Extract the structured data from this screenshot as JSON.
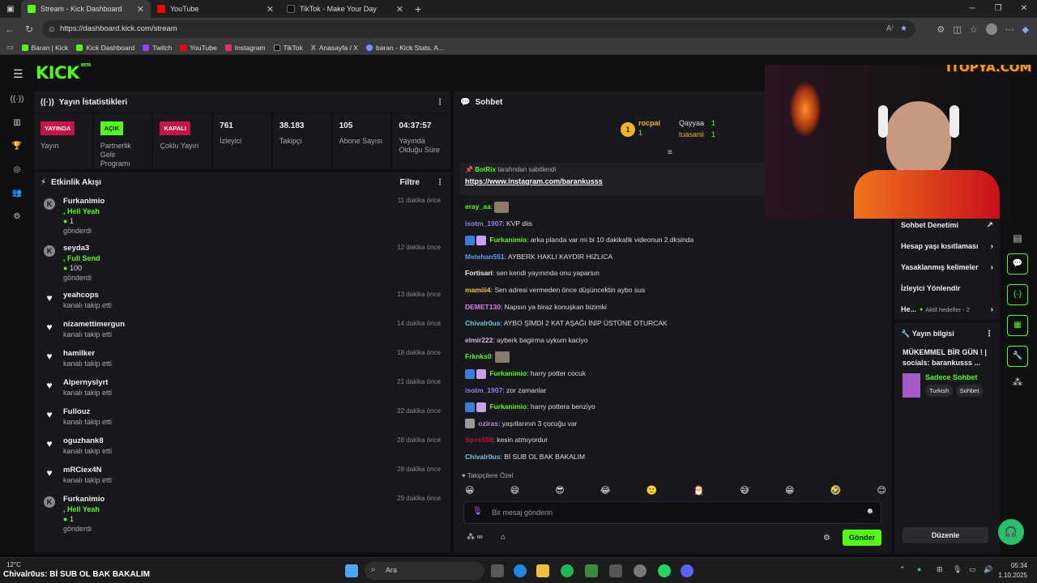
{
  "browser": {
    "tabs": [
      {
        "title": "Stream - Kick Dashboard",
        "color": "#53fc18"
      },
      {
        "title": "YouTube",
        "color": "#ff0000"
      },
      {
        "title": "TikTok - Make Your Day",
        "color": "#111111"
      }
    ],
    "url": "https://dashboard.kick.com/stream",
    "bookmarks": [
      "Baran | Kick",
      "Kick Dashboard",
      "Twitch",
      "YouTube",
      "Instagram",
      "TikTok",
      "Anasayfa / X",
      "baran - Kick Stats, A..."
    ]
  },
  "overlay": {
    "brand": "İTOPYA.COM"
  },
  "stats_panel": {
    "title": "Yayın İstatistikleri",
    "items": [
      {
        "badge": "YAYINDA",
        "label": "Yayın"
      },
      {
        "badge": "AÇIK",
        "label": "Partnerlik Gelir Programı"
      },
      {
        "badge": "KAPALI",
        "label": "Çoklu Yayın"
      },
      {
        "value": "761",
        "label": "İzleyici"
      },
      {
        "value": "38.183",
        "label": "Takipçi"
      },
      {
        "value": "105",
        "label": "Abone Sayısı"
      },
      {
        "value": "04:37:57",
        "label": "Yayında Olduğu Süre"
      }
    ]
  },
  "activity": {
    "title": "Etkinlik Akışı",
    "filter": "Filtre",
    "items": [
      {
        "user": "Furkanimio",
        "action": ", Hell Yeah",
        "amount": "1",
        "sub": "gönderdi",
        "time": "11 dakika önce",
        "kind": "kick"
      },
      {
        "user": "seyda3",
        "action": ", Full Send",
        "amount": "100",
        "sub": "gönderdi",
        "time": "12 dakika önce",
        "kind": "kick"
      },
      {
        "user": "yeahcops",
        "sub": "kanalı takip etti",
        "time": "13 dakika önce",
        "kind": "heart"
      },
      {
        "user": "nizamettimergun",
        "sub": "kanalı takip etti",
        "time": "14 dakika önce",
        "kind": "heart"
      },
      {
        "user": "hamilker",
        "sub": "kanalı takip etti",
        "time": "18 dakika önce",
        "kind": "heart"
      },
      {
        "user": "Alpernyslyrt",
        "sub": "kanalı takip etti",
        "time": "21 dakika önce",
        "kind": "heart"
      },
      {
        "user": "Fullouz",
        "sub": "kanalı takip etti",
        "time": "22 dakika önce",
        "kind": "heart"
      },
      {
        "user": "oguzhank8",
        "sub": "kanalı takip etti",
        "time": "28 dakika önce",
        "kind": "heart"
      },
      {
        "user": "mRCiex4N",
        "sub": "kanalı takip etti",
        "time": "28 dakika önce",
        "kind": "heart"
      },
      {
        "user": "Furkanimio",
        "action": ", Hell Yeah",
        "amount": "1",
        "sub": "gönderdi",
        "time": "29 dakika önce",
        "kind": "kick"
      }
    ]
  },
  "chat": {
    "title": "Sohbet",
    "leaders": [
      {
        "rank": "1",
        "name": "rocpai",
        "count": "1"
      },
      {
        "name": "Qayyaa",
        "count": "1"
      },
      {
        "name": "tuasanii",
        "count": "1"
      }
    ],
    "pinned_by": "BotRix",
    "pinned_suffix": "tarafından sabitlendi",
    "pinned_link": "https://www.instagram.com/barankusss",
    "messages": [
      {
        "user": "eray_aa",
        "text": "",
        "color": "#53fc18"
      },
      {
        "user": "isotm_1907",
        "text": ": KVP diis",
        "color": "#9b7cf5"
      },
      {
        "user": "Furkanimio",
        "text": ": arka planda var mi bi 10 dakikalik videonun 2.dksinda",
        "color": "#53fc18"
      },
      {
        "user": "Metehan551",
        "text": ": AYBERK HAKLI KAYDIR HIZLICA",
        "color": "#5aa0f7"
      },
      {
        "user": "Fortisari",
        "text": ": sen kendi yayınında onu yaparsın",
        "color": "#eeeeee"
      },
      {
        "user": "mamiii4",
        "text": ": Sen adresi vermeden önce düşüncektin aybo sus",
        "color": "#f0c330"
      },
      {
        "user": "DEMET130",
        "text": ": Napsın ya biraz konuşkan bizimki",
        "color": "#e07bf0"
      },
      {
        "user": "Chivalr0us",
        "text": ": AYBO ŞİMDİ 2 KAT AŞAĞI İNİP ÜSTÜNE OTURCAK",
        "color": "#6ec3e8"
      },
      {
        "user": "elmir222",
        "text": ": ayberk bagirma uykum kaciyo",
        "color": "#d7b2f0"
      },
      {
        "user": "Frknks0",
        "text": ":",
        "color": "#53fc18"
      },
      {
        "user": "Furkanimio",
        "text": ": harry potter cocuk",
        "color": "#53fc18"
      },
      {
        "user": "isotm_1907",
        "text": ": zor zamanlar",
        "color": "#9b7cf5"
      },
      {
        "user": "Furkanimio",
        "text": ": harry pottera benziyo",
        "color": "#53fc18"
      },
      {
        "user": "oziras",
        "text": ": yaşıtlarının 3 çocuğu var",
        "color": "#b480f0"
      },
      {
        "user": "Spes558",
        "text": ": kesin atmıyordur",
        "color": "#c0143c"
      },
      {
        "user": "Chivalr0us",
        "text": ": Bİ SUB OL BAK BAKALIM",
        "color": "#6ec3e8"
      }
    ],
    "followers_only": "Takipçilere Özel",
    "input_placeholder": "Bir mesaj gönderin",
    "send": "Gönder"
  },
  "right_panel": {
    "rows": [
      "Sohbet Denetimi",
      "Hesap yaşı kısıtlaması",
      "Yasaklanmış kelimeler",
      "İzleyici Yönlendir"
    ],
    "goals_prefix": "He...",
    "goals": "Aktif hedefler - 2",
    "info_title": "Yayın bilgisi",
    "stream_title": "MÜKEMMEL BİR GÜN ! | socials: barankusss ...",
    "category": "Sadece Sohbet",
    "tags": [
      "Turkish",
      "Sohbet"
    ],
    "edit": "Düzenle"
  },
  "taskbar": {
    "weather": "12°C",
    "ticker": "Chivalr0us: Bİ SUB OL BAK BAKALIM",
    "search": "Ara",
    "time": "05:34",
    "date": "1.10.2025"
  }
}
